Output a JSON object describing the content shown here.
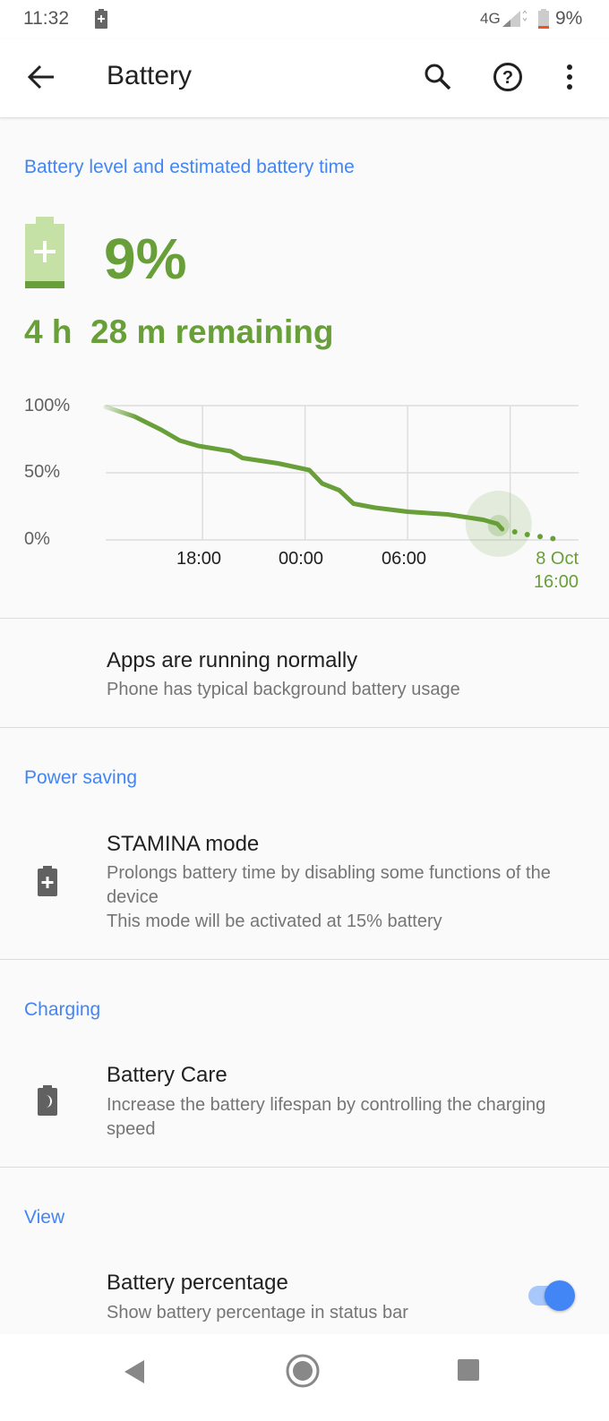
{
  "status_bar": {
    "time": "11:32",
    "network": "4G",
    "battery": "9%"
  },
  "app_bar": {
    "title": "Battery",
    "icons": [
      "back-arrow-icon",
      "search-icon",
      "help-icon",
      "more-vert-icon"
    ]
  },
  "battery_section": {
    "header": "Battery level and estimated battery time",
    "level": "9%",
    "remaining": "4 h  28 m remaining",
    "accent_color": "#689f38"
  },
  "chart_data": {
    "type": "line",
    "ylim": [
      0,
      100
    ],
    "y_ticks": [
      "100%",
      "50%",
      "0%"
    ],
    "y_tick_values": [
      100,
      50,
      0
    ],
    "x_tick_labels": [
      "18:00",
      "00:00",
      "06:00"
    ],
    "x_end_label": [
      "8 Oct",
      "16:00"
    ],
    "x_range": [
      "12:20",
      "16:00"
    ],
    "grid": true,
    "series": [
      {
        "style": "solid",
        "x": [
          "12:20",
          "14:00",
          "15:35",
          "16:40",
          "17:45",
          "19:40",
          "20:20",
          "22:25",
          "00:15",
          "01:00",
          "02:00",
          "02:50",
          "04:05",
          "06:00",
          "08:20",
          "10:25",
          "11:15",
          "11:32"
        ],
        "y": [
          99,
          92,
          82,
          74,
          70,
          66,
          61,
          57,
          52,
          42,
          37,
          27,
          24,
          21,
          19,
          15,
          12,
          8
        ]
      },
      {
        "style": "dotted",
        "x": [
          "11:32",
          "13:00",
          "14:30"
        ],
        "y": [
          8,
          4,
          1
        ]
      }
    ],
    "current_marker": {
      "x": "11:32",
      "y": 8
    }
  },
  "apps_item": {
    "title": "Apps are running normally",
    "subtitle": "Phone has typical background battery usage"
  },
  "power_saving": {
    "header": "Power saving",
    "title": "STAMINA mode",
    "subtitle1": "Prolongs battery time by disabling some functions of the device",
    "subtitle2": "This mode will be activated at 15% battery"
  },
  "charging": {
    "header": "Charging",
    "title": "Battery Care",
    "subtitle": "Increase the battery lifespan by controlling the charging speed"
  },
  "view": {
    "header": "View",
    "title": "Battery percentage",
    "subtitle": "Show battery percentage in status bar",
    "toggle_on": true,
    "toggle_color": "#4285f4"
  }
}
